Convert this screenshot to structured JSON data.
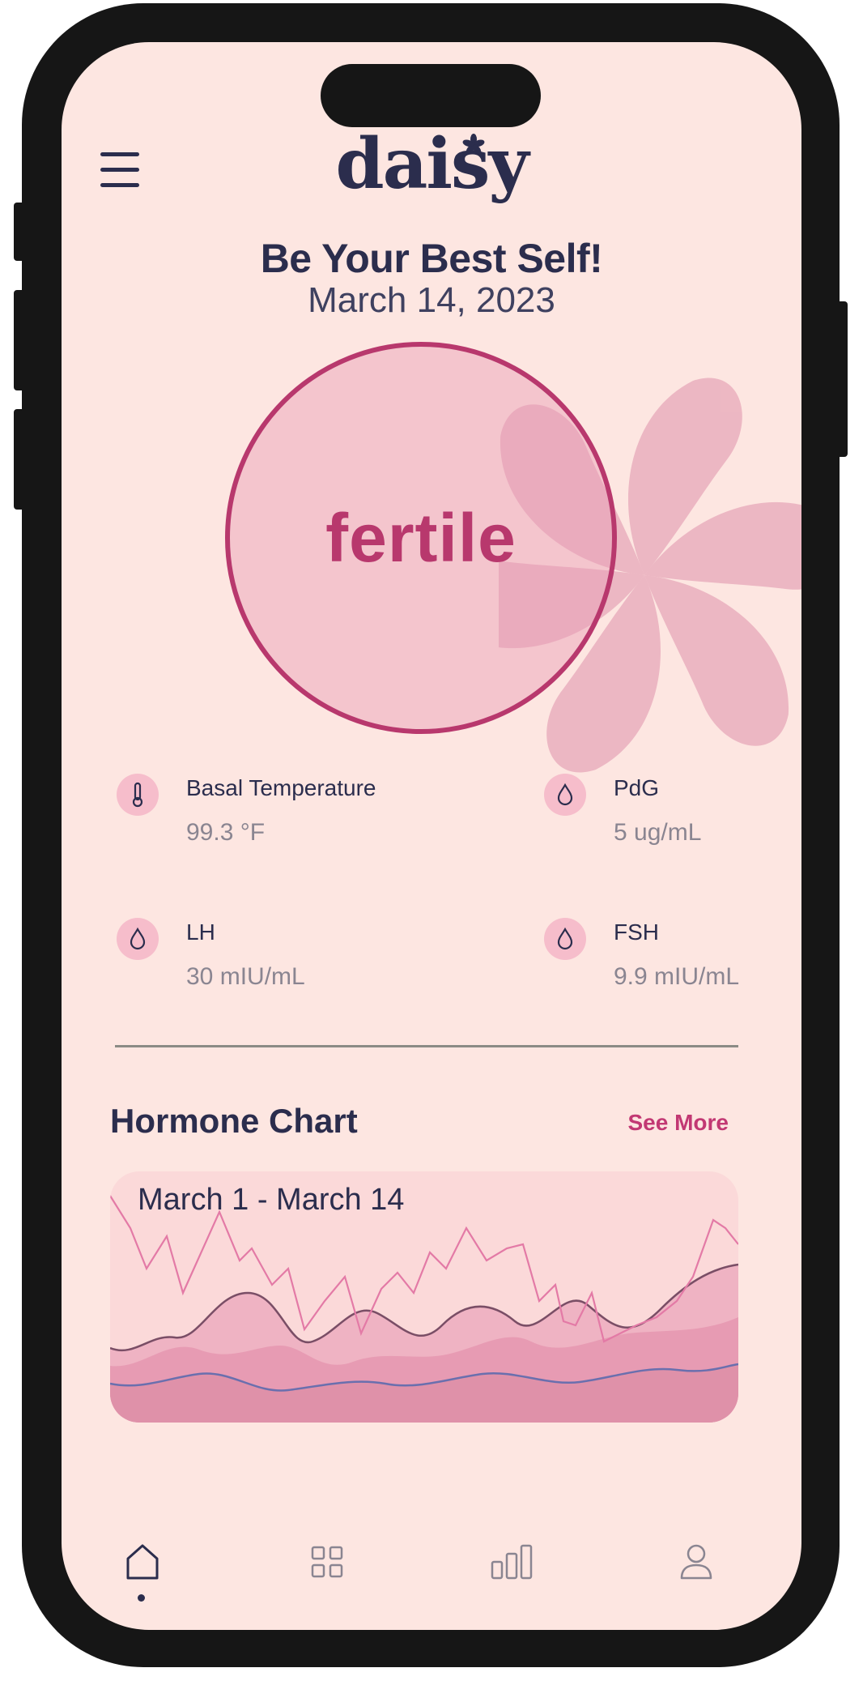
{
  "app": {
    "logo": "daisy"
  },
  "header": {
    "headline": "Be Your Best Self!",
    "date": "March 14, 2023"
  },
  "status": {
    "label": "fertile"
  },
  "metrics": [
    {
      "label": "Basal Temperature",
      "value": "99.3 °F",
      "icon": "thermometer-icon"
    },
    {
      "label": "PdG",
      "value": "5 ug/mL",
      "icon": "droplet-icon"
    },
    {
      "label": "LH",
      "value": "30 mIU/mL",
      "icon": "droplet-icon"
    },
    {
      "label": "FSH",
      "value": "9.9 mIU/mL",
      "icon": "droplet-icon"
    }
  ],
  "hormone_chart": {
    "title": "Hormone Chart",
    "see_more": "See More",
    "range": "March 1 - March 14"
  },
  "tabbar": {
    "items": [
      "home-icon",
      "grid-icon",
      "stats-icon",
      "profile-icon"
    ],
    "active": "home-icon"
  },
  "colors": {
    "background": "#fde6e1",
    "accent": "#b8386d",
    "text": "#2b2d4d",
    "frame": "#161616"
  }
}
